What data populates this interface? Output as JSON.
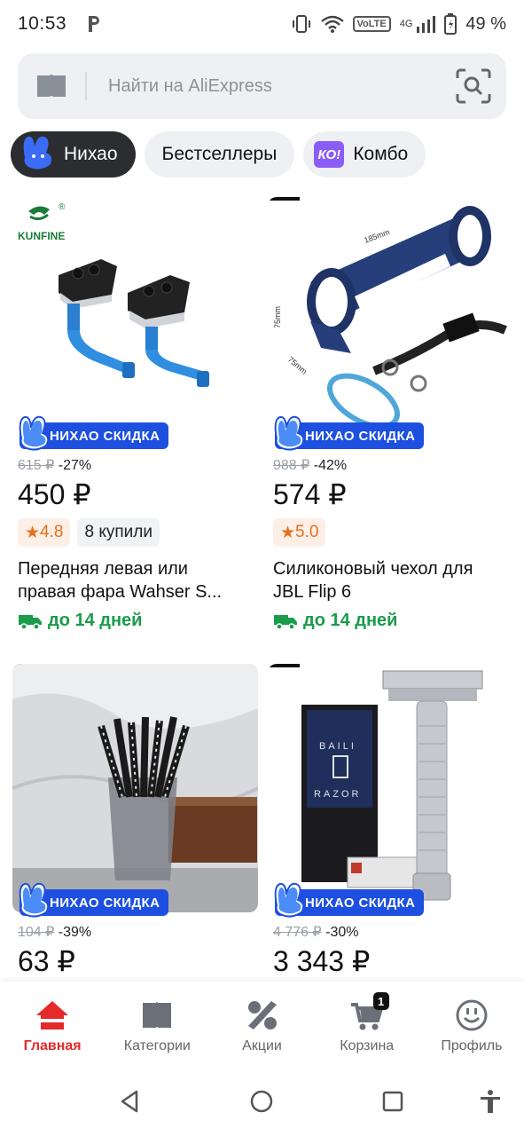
{
  "status": {
    "time": "10:53",
    "volte": "VoLTE",
    "network": "4G",
    "battery": "49 %"
  },
  "search": {
    "placeholder": "Найти на AliExpress"
  },
  "chips": [
    {
      "label": "Нихао"
    },
    {
      "label": "Бестселлеры"
    },
    {
      "label": "Комбо",
      "icon_text": "КО!"
    }
  ],
  "products": [
    {
      "badge": "НИХАО СКИДКА",
      "old_price": "615 ₽",
      "discount": "-27%",
      "price": "450 ₽",
      "rating": "4.8",
      "sold": "8 купили",
      "title_line1": "Передняя левая или",
      "title_line2": "правая фара Wahser S...",
      "delivery": "до 14 дней",
      "brand": "KUNFINE"
    },
    {
      "badge": "НИХАО СКИДКА",
      "old_price": "988 ₽",
      "discount": "-42%",
      "price": "574 ₽",
      "rating": "5.0",
      "title_line1": "Силиконовый чехол для",
      "title_line2": "JBL Flip 6",
      "delivery": "до 14 дней",
      "dims": [
        "185mm",
        "75mm",
        "75mm"
      ]
    },
    {
      "badge": "НИХАО СКИДКА",
      "old_price": "104 ₽",
      "discount": "-39%",
      "price": "63 ₽"
    },
    {
      "badge": "НИХАО СКИДКА",
      "old_price": "4 776 ₽",
      "discount": "-30%",
      "price": "3 343 ₽",
      "box_text": [
        "BAILI",
        "RAZOR"
      ]
    }
  ],
  "nav": {
    "home": "Главная",
    "categories": "Категории",
    "sales": "Акции",
    "cart": "Корзина",
    "cart_count": "1",
    "profile": "Профиль"
  },
  "colors": {
    "accent_red": "#e52a2a",
    "badge_blue": "#1d4fe0",
    "delivery_green": "#1a9c4a",
    "rating_orange": "#e5711e"
  }
}
